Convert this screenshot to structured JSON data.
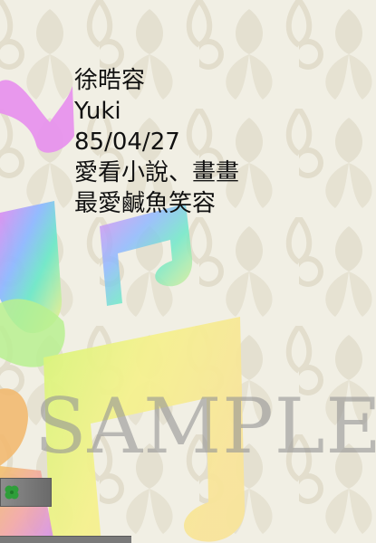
{
  "profile": {
    "name": "徐晧容",
    "nickname": "Yuki",
    "birthday": "85/04/27",
    "hobbies": "愛看小說、畫畫",
    "favorite": "最愛鹹魚笑容"
  },
  "watermark": "SAMPLE",
  "colors": {
    "background": "#f1efe4",
    "pattern": "#e3dfcf",
    "text": "#111111",
    "watermark": "#969696"
  }
}
